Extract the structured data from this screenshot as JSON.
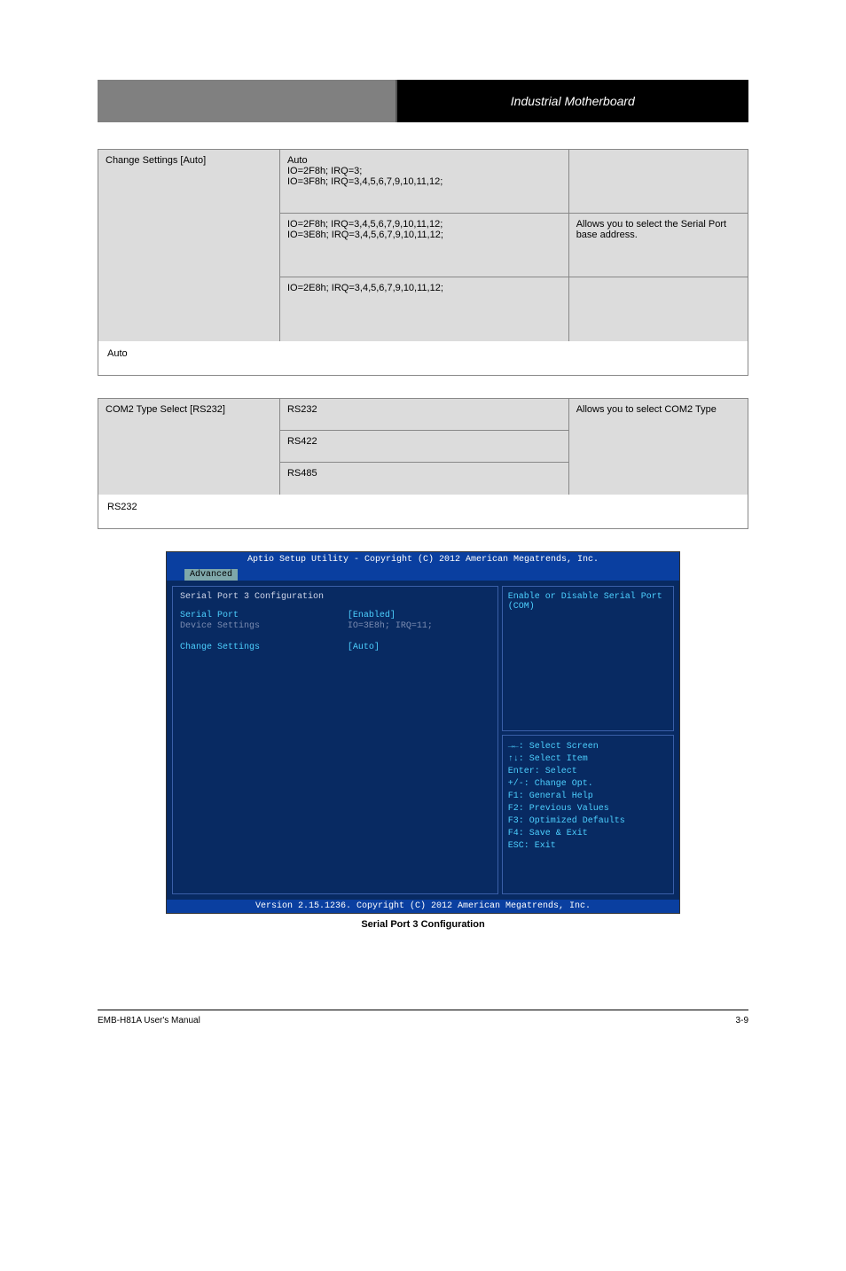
{
  "header": {
    "right_text": "Industrial Motherboard"
  },
  "table1": {
    "left": "Change Settings [Auto]",
    "mid": [
      "Auto\nIO=2F8h; IRQ=3;\nIO=3F8h; IRQ=3,4,5,6,7,9,10,11,12;",
      "IO=2F8h; IRQ=3,4,5,6,7,9,10,11,12;\nIO=3E8h; IRQ=3,4,5,6,7,9,10,11,12;",
      "IO=2E8h; IRQ=3,4,5,6,7,9,10,11,12;"
    ],
    "right": [
      "",
      "Allows you to select the Serial Port base address.",
      ""
    ],
    "fullrow": "Auto"
  },
  "table2": {
    "left": "COM2 Type Select [RS232]",
    "mid": [
      "RS232",
      "RS422",
      "RS485"
    ],
    "right": "Allows you to select COM2 Type",
    "fullrow": "RS232"
  },
  "bios": {
    "header": "Aptio Setup Utility - Copyright (C) 2012 American Megatrends, Inc.",
    "tab": "Advanced",
    "left": {
      "title": "Serial Port 3 Configuration",
      "rows": [
        {
          "label": "Serial Port",
          "value": "[Enabled]",
          "cls": "cyan"
        },
        {
          "label": "Device Settings",
          "value": "IO=3E8h; IRQ=11;",
          "cls": "gray"
        },
        {
          "label": "",
          "value": ""
        },
        {
          "label": "Change Settings",
          "value": "[Auto]",
          "cls": "cyan"
        }
      ]
    },
    "right_top": "Enable or Disable Serial Port\n(COM)",
    "right_bot": "→←: Select Screen\n↑↓: Select Item\nEnter: Select\n+/-: Change Opt.\nF1: General Help\nF2: Previous Values\nF3: Optimized Defaults\nF4: Save & Exit\nESC: Exit",
    "footer": "Version 2.15.1236. Copyright (C) 2012 American Megatrends, Inc."
  },
  "caption": "Serial Port 3 Configuration",
  "footer": {
    "manual": "EMB-H81A User's Manual",
    "page": "3-9"
  }
}
